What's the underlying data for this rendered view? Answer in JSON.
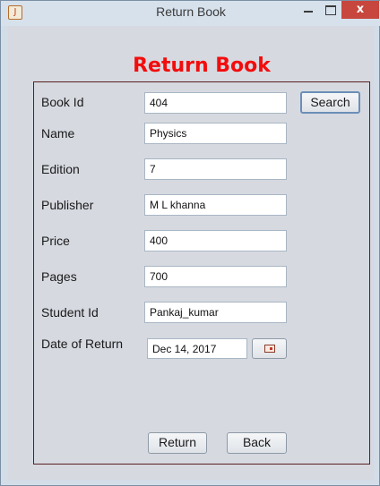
{
  "window": {
    "title": "Return Book",
    "close_glyph": "x",
    "app_icon_glyph": "J"
  },
  "heading": "Return Book",
  "form": {
    "book_id": {
      "label": "Book Id",
      "value": "404"
    },
    "name": {
      "label": "Name",
      "value": "Physics"
    },
    "edition": {
      "label": "Edition",
      "value": "7"
    },
    "publisher": {
      "label": "Publisher",
      "value": "M L khanna"
    },
    "price": {
      "label": "Price",
      "value": "400"
    },
    "pages": {
      "label": "Pages",
      "value": "700"
    },
    "student_id": {
      "label": "Student Id",
      "value": "Pankaj_kumar"
    },
    "date_of_return": {
      "label": "Date of Return",
      "value": "Dec 14, 2017"
    }
  },
  "buttons": {
    "search": "Search",
    "return": "Return",
    "back": "Back"
  },
  "colors": {
    "heading": "#f20d0d",
    "panel_border": "#5a1f1f",
    "window_bg": "#d6d9e0"
  },
  "icons": {
    "app": "java-app-icon",
    "calendar": "calendar-icon",
    "minimize": "minimize-icon",
    "maximize": "maximize-icon",
    "close": "close-icon"
  }
}
